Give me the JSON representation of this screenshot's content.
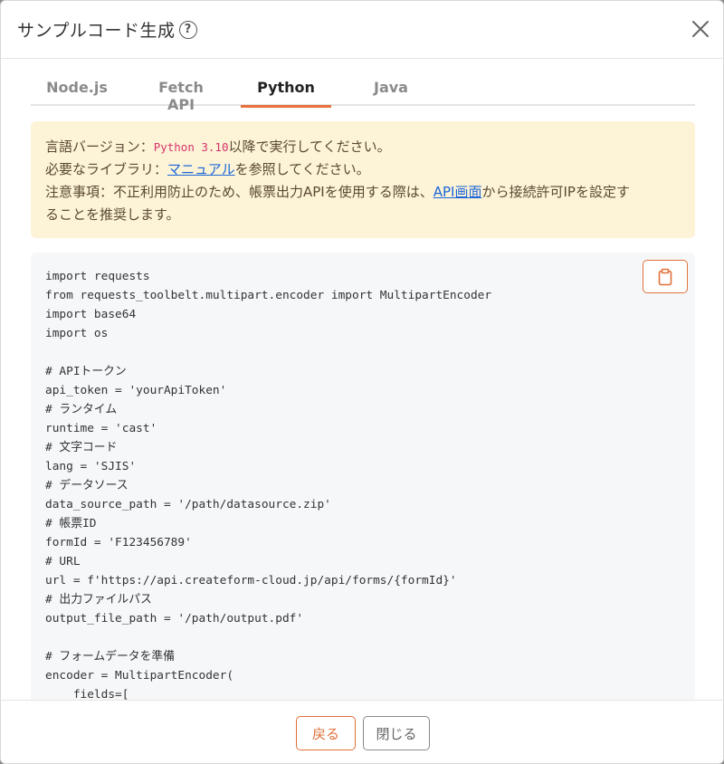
{
  "header": {
    "title": "サンプルコード生成",
    "help_glyph": "?"
  },
  "tabs": [
    {
      "label": "Node.js",
      "active": false
    },
    {
      "label": "Fetch API",
      "active": false
    },
    {
      "label": "Python",
      "active": true
    },
    {
      "label": "Java",
      "active": false
    }
  ],
  "notice": {
    "line1_prefix": "言語バージョン：",
    "line1_version": "Python 3.10",
    "line1_suffix": "以降で実行してください。",
    "line2_prefix": "必要なライブラリ：",
    "line2_link": "マニュアル",
    "line2_suffix": "を参照してください。",
    "line3_prefix": "注意事項：不正利用防止のため、帳票出力APIを使用する際は、",
    "line3_link": "API画面",
    "line3_suffix": "から接続許可IPを設定す",
    "line4": "ることを推奨します。"
  },
  "code": {
    "lines": [
      "import requests",
      "from requests_toolbelt.multipart.encoder import MultipartEncoder",
      "import base64",
      "import os",
      "",
      "# APIトークン",
      "api_token = 'yourApiToken'",
      "# ランタイム",
      "runtime = 'cast'",
      "# 文字コード",
      "lang = 'SJIS'",
      "# データソース",
      "data_source_path = '/path/datasource.zip'",
      "# 帳票ID",
      "formId = 'F123456789'",
      "# URL",
      "url = f'https://api.createform-cloud.jp/api/forms/{formId}'",
      "# 出力ファイルパス",
      "output_file_path = '/path/output.pdf'",
      "",
      "# フォームデータを準備",
      "encoder = MultipartEncoder(",
      "    fields=["
    ]
  },
  "footer": {
    "back_label": "戻る",
    "close_label": "閉じる"
  },
  "colors": {
    "accent": "#e0703a",
    "notice_bg": "#fdf3d6",
    "link": "#1a66d9",
    "version_text": "#d6336c"
  }
}
